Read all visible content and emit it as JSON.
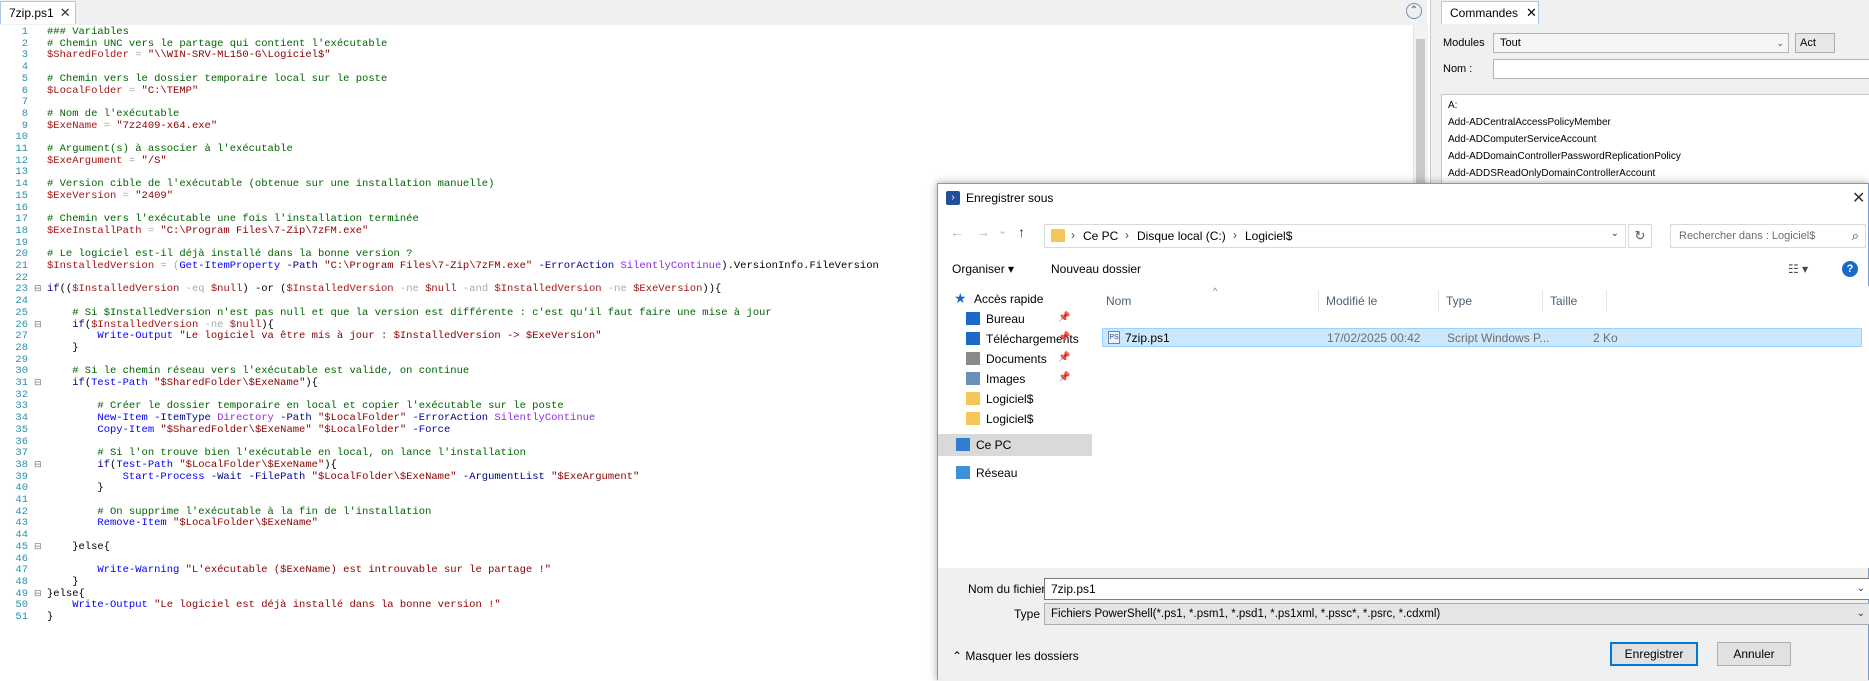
{
  "editor": {
    "tab_label": "7zip.ps1",
    "close_glyph": "✕",
    "collapse_glyph": "⌃",
    "lines": [
      {
        "n": "1",
        "segs": [
          {
            "t": "### Variables",
            "c": "com"
          }
        ]
      },
      {
        "n": "2",
        "segs": [
          {
            "t": "# Chemin UNC vers le partage qui contient l'exécutable",
            "c": "com"
          }
        ]
      },
      {
        "n": "3",
        "segs": [
          {
            "t": "$SharedFolder",
            "c": "var"
          },
          {
            "t": " = ",
            "c": "op"
          },
          {
            "t": "\"\\\\WIN-SRV-ML150-G\\Logiciel$\"",
            "c": "str"
          }
        ]
      },
      {
        "n": "4",
        "segs": []
      },
      {
        "n": "5",
        "segs": [
          {
            "t": "# Chemin vers le dossier temporaire local sur le poste",
            "c": "com"
          }
        ]
      },
      {
        "n": "6",
        "segs": [
          {
            "t": "$LocalFolder",
            "c": "var"
          },
          {
            "t": " = ",
            "c": "op"
          },
          {
            "t": "\"C:\\TEMP\"",
            "c": "str"
          }
        ]
      },
      {
        "n": "7",
        "segs": []
      },
      {
        "n": "8",
        "segs": [
          {
            "t": "# Nom de l'exécutable",
            "c": "com"
          }
        ]
      },
      {
        "n": "9",
        "segs": [
          {
            "t": "$ExeName",
            "c": "var"
          },
          {
            "t": " = ",
            "c": "op"
          },
          {
            "t": "\"7z2409-x64.exe\"",
            "c": "str"
          }
        ]
      },
      {
        "n": "10",
        "segs": []
      },
      {
        "n": "11",
        "segs": [
          {
            "t": "# Argument(s) à associer à l'exécutable",
            "c": "com"
          }
        ]
      },
      {
        "n": "12",
        "segs": [
          {
            "t": "$ExeArgument",
            "c": "var"
          },
          {
            "t": " = ",
            "c": "op"
          },
          {
            "t": "\"/S\"",
            "c": "str"
          }
        ]
      },
      {
        "n": "13",
        "segs": []
      },
      {
        "n": "14",
        "segs": [
          {
            "t": "# Version cible de l'exécutable (obtenue sur une installation manuelle)",
            "c": "com"
          }
        ]
      },
      {
        "n": "15",
        "segs": [
          {
            "t": "$ExeVersion",
            "c": "var"
          },
          {
            "t": " = ",
            "c": "op"
          },
          {
            "t": "\"2409\"",
            "c": "str"
          }
        ]
      },
      {
        "n": "16",
        "segs": []
      },
      {
        "n": "17",
        "segs": [
          {
            "t": "# Chemin vers l'exécutable une fois l'installation terminée",
            "c": "com"
          }
        ]
      },
      {
        "n": "18",
        "segs": [
          {
            "t": "$ExeInstallPath",
            "c": "var"
          },
          {
            "t": " = ",
            "c": "op"
          },
          {
            "t": "\"C:\\Program Files\\7-Zip\\7zFM.exe\"",
            "c": "str"
          }
        ]
      },
      {
        "n": "19",
        "segs": []
      },
      {
        "n": "20",
        "segs": [
          {
            "t": "# Le logiciel est-il déjà installé dans la bonne version ?",
            "c": "com"
          }
        ]
      },
      {
        "n": "21",
        "segs": [
          {
            "t": "$InstalledVersion",
            "c": "var"
          },
          {
            "t": " = (",
            "c": "op"
          },
          {
            "t": "Get-ItemProperty",
            "c": "cmd"
          },
          {
            "t": " -Path ",
            "c": "kw"
          },
          {
            "t": "\"C:\\Program Files\\7-Zip\\7zFM.exe\"",
            "c": "str"
          },
          {
            "t": " -ErrorAction ",
            "c": "kw"
          },
          {
            "t": "SilentlyContinue",
            "c": "par"
          },
          {
            "t": ").VersionInfo.FileVersion",
            "c": "plain"
          }
        ]
      },
      {
        "n": "22",
        "segs": []
      },
      {
        "n": "23",
        "fold": "⊟",
        "segs": [
          {
            "t": "if",
            "c": "kw"
          },
          {
            "t": "((",
            "c": "plain"
          },
          {
            "t": "$InstalledVersion",
            "c": "var"
          },
          {
            "t": " -eq ",
            "c": "op"
          },
          {
            "t": "$null",
            "c": "var"
          },
          {
            "t": ") -or (",
            "c": "plain"
          },
          {
            "t": "$InstalledVersion",
            "c": "var"
          },
          {
            "t": " -ne ",
            "c": "op"
          },
          {
            "t": "$null",
            "c": "var"
          },
          {
            "t": " -and ",
            "c": "op"
          },
          {
            "t": "$InstalledVersion",
            "c": "var"
          },
          {
            "t": " -ne ",
            "c": "op"
          },
          {
            "t": "$ExeVersion",
            "c": "var"
          },
          {
            "t": ")){",
            "c": "plain"
          }
        ]
      },
      {
        "n": "24",
        "segs": []
      },
      {
        "n": "25",
        "segs": [
          {
            "t": "    # Si $InstalledVersion n'est pas null et que la version est différente : c'est qu'il faut faire une mise à jour",
            "c": "com"
          }
        ]
      },
      {
        "n": "26",
        "fold": "⊟",
        "segs": [
          {
            "t": "    if",
            "c": "kw"
          },
          {
            "t": "(",
            "c": "plain"
          },
          {
            "t": "$InstalledVersion",
            "c": "var"
          },
          {
            "t": " -ne ",
            "c": "op"
          },
          {
            "t": "$null",
            "c": "var"
          },
          {
            "t": "){",
            "c": "plain"
          }
        ]
      },
      {
        "n": "27",
        "segs": [
          {
            "t": "        Write-Output",
            "c": "cmd"
          },
          {
            "t": " \"Le logiciel va être mis à jour : $InstalledVersion -> $ExeVersion\"",
            "c": "str"
          }
        ]
      },
      {
        "n": "28",
        "segs": [
          {
            "t": "    }",
            "c": "plain"
          }
        ]
      },
      {
        "n": "29",
        "segs": []
      },
      {
        "n": "30",
        "segs": [
          {
            "t": "    # Si le chemin réseau vers l'exécutable est valide, on continue",
            "c": "com"
          }
        ]
      },
      {
        "n": "31",
        "fold": "⊟",
        "segs": [
          {
            "t": "    if",
            "c": "kw"
          },
          {
            "t": "(",
            "c": "plain"
          },
          {
            "t": "Test-Path",
            "c": "cmd"
          },
          {
            "t": " \"$SharedFolder\\$ExeName\"",
            "c": "str"
          },
          {
            "t": "){",
            "c": "plain"
          }
        ]
      },
      {
        "n": "32",
        "segs": []
      },
      {
        "n": "33",
        "segs": [
          {
            "t": "        # Créer le dossier temporaire en local et copier l'exécutable sur le poste",
            "c": "com"
          }
        ]
      },
      {
        "n": "34",
        "segs": [
          {
            "t": "        New-Item",
            "c": "cmd"
          },
          {
            "t": " -ItemType ",
            "c": "kw"
          },
          {
            "t": "Directory",
            "c": "par"
          },
          {
            "t": " -Path ",
            "c": "kw"
          },
          {
            "t": "\"$LocalFolder\"",
            "c": "str"
          },
          {
            "t": " -ErrorAction ",
            "c": "kw"
          },
          {
            "t": "SilentlyContinue",
            "c": "par"
          }
        ]
      },
      {
        "n": "35",
        "segs": [
          {
            "t": "        Copy-Item",
            "c": "cmd"
          },
          {
            "t": " \"$SharedFolder\\$ExeName\" \"$LocalFolder\"",
            "c": "str"
          },
          {
            "t": " -Force",
            "c": "kw"
          }
        ]
      },
      {
        "n": "36",
        "segs": []
      },
      {
        "n": "37",
        "segs": [
          {
            "t": "        # Si l'on trouve bien l'exécutable en local, on lance l'installation",
            "c": "com"
          }
        ]
      },
      {
        "n": "38",
        "fold": "⊟",
        "segs": [
          {
            "t": "        if",
            "c": "kw"
          },
          {
            "t": "(",
            "c": "plain"
          },
          {
            "t": "Test-Path",
            "c": "cmd"
          },
          {
            "t": " \"$LocalFolder\\$ExeName\"",
            "c": "str"
          },
          {
            "t": "){",
            "c": "plain"
          }
        ]
      },
      {
        "n": "39",
        "segs": [
          {
            "t": "            Start-Process",
            "c": "cmd"
          },
          {
            "t": " -Wait -FilePath ",
            "c": "kw"
          },
          {
            "t": "\"$LocalFolder\\$ExeName\"",
            "c": "str"
          },
          {
            "t": " -ArgumentList ",
            "c": "kw"
          },
          {
            "t": "\"$ExeArgument\"",
            "c": "str"
          }
        ]
      },
      {
        "n": "40",
        "segs": [
          {
            "t": "        }",
            "c": "plain"
          }
        ]
      },
      {
        "n": "41",
        "segs": []
      },
      {
        "n": "42",
        "segs": [
          {
            "t": "        # On supprime l'exécutable à la fin de l'installation",
            "c": "com"
          }
        ]
      },
      {
        "n": "43",
        "segs": [
          {
            "t": "        Remove-Item",
            "c": "cmd"
          },
          {
            "t": " \"$LocalFolder\\$ExeName\"",
            "c": "str"
          }
        ]
      },
      {
        "n": "44",
        "segs": []
      },
      {
        "n": "45",
        "fold": "⊟",
        "segs": [
          {
            "t": "    }else{",
            "c": "plain"
          }
        ]
      },
      {
        "n": "46",
        "segs": []
      },
      {
        "n": "47",
        "segs": [
          {
            "t": "        Write-Warning",
            "c": "cmd"
          },
          {
            "t": " \"L'exécutable ($ExeName) est introuvable sur le partage !\"",
            "c": "str"
          }
        ]
      },
      {
        "n": "48",
        "segs": [
          {
            "t": "    }",
            "c": "plain"
          }
        ]
      },
      {
        "n": "49",
        "fold": "⊟",
        "segs": [
          {
            "t": "}else{",
            "c": "plain"
          }
        ]
      },
      {
        "n": "50",
        "segs": [
          {
            "t": "    Write-Output",
            "c": "cmd"
          },
          {
            "t": " \"Le logiciel est déjà installé dans la bonne version !\"",
            "c": "str"
          }
        ]
      },
      {
        "n": "51",
        "segs": [
          {
            "t": "}",
            "c": "plain"
          }
        ]
      }
    ]
  },
  "commands": {
    "tab_label": "Commandes",
    "close_glyph": "✕",
    "modules_label": "Modules",
    "modules_value": "Tout",
    "act_button": "Act",
    "name_label": "Nom :",
    "name_value": "",
    "items": [
      "A:",
      "Add-ADCentralAccessPolicyMember",
      "Add-ADComputerServiceAccount",
      "Add-ADDomainControllerPasswordReplicationPolicy",
      "Add-ADDSReadOnlyDomainControllerAccount"
    ]
  },
  "dialog": {
    "title": "Enregistrer sous",
    "close_glyph": "✕",
    "back_glyph": "←",
    "forward_glyph": "→",
    "recent_glyph": "⌄",
    "up_glyph": "↑",
    "breadcrumb": [
      "Ce PC",
      "Disque local (C:)",
      "Logiciel$"
    ],
    "crumb_sep": "›",
    "refresh_glyph": "↻",
    "search_placeholder": "Rechercher dans : Logiciel$",
    "search_glyph": "⌕",
    "organize_label": "Organiser ▾",
    "newfolder_label": "Nouveau dossier",
    "view_glyph": "☷ ▾",
    "help_glyph": "?",
    "nav": {
      "quick_access": "Accès rapide",
      "items": [
        {
          "label": "Bureau",
          "icon": "desktop-icon",
          "color": "#1b6ac9",
          "pin": "📌"
        },
        {
          "label": "Téléchargements",
          "icon": "downloads-icon",
          "color": "#1b6ac9",
          "pin": "📌"
        },
        {
          "label": "Documents",
          "icon": "documents-icon",
          "color": "#8a8a8a",
          "pin": "📌"
        },
        {
          "label": "Images",
          "icon": "pictures-icon",
          "color": "#6a8fb8",
          "pin": "📌"
        },
        {
          "label": "Logiciel$",
          "icon": "folder-icon",
          "color": "#f3c755",
          "pin": ""
        },
        {
          "label": "Logiciel$",
          "icon": "folder-icon",
          "color": "#f3c755",
          "pin": ""
        }
      ],
      "this_pc": "Ce PC",
      "network": "Réseau"
    },
    "columns": [
      "Nom",
      "Modifié le",
      "Type",
      "Taille"
    ],
    "sort_glyph": "^",
    "file": {
      "name": "7zip.ps1",
      "modified": "17/02/2025 00:42",
      "type": "Script Windows P...",
      "size": "2 Ko",
      "icon_text": "PS"
    },
    "filename_label": "Nom du fichier :",
    "filename_value": "7zip.ps1",
    "filetype_label": "Type :",
    "filetype_value": "Fichiers PowerShell(*.ps1, *.psm1, *.psd1, *.ps1xml, *.pssc*, *.psrc, *.cdxml)",
    "dd_glyph": "⌄",
    "hide_folders": "⌃  Masquer les dossiers",
    "save_button": "Enregistrer",
    "cancel_button": "Annuler"
  }
}
